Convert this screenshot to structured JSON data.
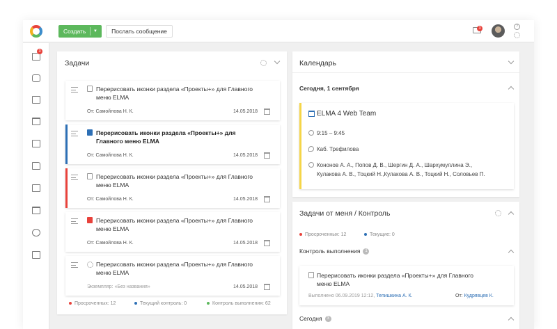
{
  "topbar": {
    "create_label": "Создать",
    "post_label": "Послать сообщение",
    "mail_count": "3",
    "help_glyph": "?"
  },
  "leftnav": {
    "mail_count": "3",
    "icons": [
      "mail-icon",
      "phone-icon",
      "clipboard-icon",
      "calendar-icon",
      "contact-icon",
      "folder-icon",
      "report-icon",
      "briefcase-icon",
      "gauge-icon",
      "bookmark-icon"
    ]
  },
  "tasks_panel": {
    "title": "Задачи",
    "cards": [
      {
        "title": "Перерисовать иконки раздела «Проекты+» для Главного меню ELMA",
        "from": "От: Самойлова Н. К.",
        "date": "14.05.2018",
        "accent": "",
        "bold": false,
        "icon": "doc"
      },
      {
        "title": "Перерисовать иконки раздела «Проекты+» для Главного меню ELMA",
        "from": "От: Самойлова Н. К.",
        "date": "14.05.2018",
        "accent": "#2d6fb5",
        "bold": true,
        "icon": "doc-blue"
      },
      {
        "title": "Перерисовать иконки раздела «Проекты+» для Главного меню ELMA",
        "from": "От: Самойлова Н. К.",
        "date": "14.05.2018",
        "accent": "#e8423b",
        "bold": false,
        "icon": "doc"
      },
      {
        "title": "Перерисовать иконки раздела «Проекты+» для Главного меню ELMA",
        "from": "От: Самойлова Н. К.",
        "date": "14.05.2018",
        "accent": "",
        "bold": false,
        "icon": "doc-red"
      },
      {
        "title": "Перерисовать иконки раздела «Проекты+» для Главного меню ELMA",
        "from": "Экземпляр: «Без названия»",
        "date": "14.05.2018",
        "accent": "",
        "bold": false,
        "icon": "spinner"
      }
    ],
    "legend": {
      "overdue": "Просроченных: 12",
      "current": "Текущий контроль: 0",
      "done": "Контроль выполнения: 62"
    }
  },
  "calendar_panel": {
    "title": "Календарь",
    "today": "Сегодня, 1 сентября",
    "event": {
      "title": "ELMA 4 Web Team",
      "time": "9:15 – 9:45",
      "place": "Каб. Трефилова",
      "people_line1": "Кононов А. А., Попов Д. В., Шергин Д. А., Шархумуллина Э.,",
      "people_line2": "Кулакова А. В., Тоцкий Н.,Кулакова А. В., Тоцкий Н., Соловьев П."
    }
  },
  "control_panel": {
    "title": "Задачи от меня / Контроль",
    "legend": {
      "overdue": "Просроченных: 12",
      "current": "Текущие: 0"
    },
    "section_title": "Контроль выполнения",
    "section_count": "1",
    "card": {
      "title_line1": "Перерисовать иконки раздела «Проекты+»  для Главного",
      "title_line2": "меню ELMA",
      "done_prefix": "Выполнено 06.09.2019  12:12,",
      "done_person": "Тепишкина А. К.",
      "from_prefix": "От:",
      "from_person": "Кудрявцев К."
    },
    "today_title": "Сегодня",
    "today_count": "3"
  },
  "colors": {
    "accent_green": "#5cb85c",
    "accent_blue": "#2d6fb5",
    "accent_red": "#e8423b",
    "event_yellow": "#f5d547"
  }
}
